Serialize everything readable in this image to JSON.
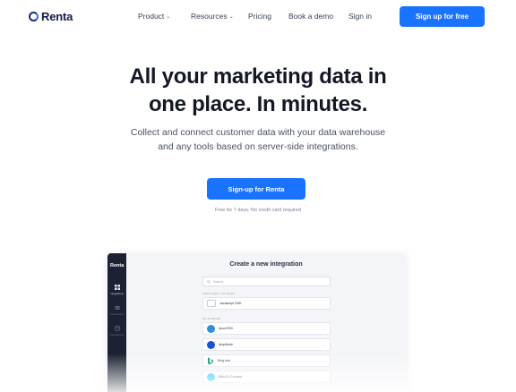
{
  "brand": {
    "name": "Renta",
    "accent": "#1a73ff",
    "dark": "#16194a"
  },
  "nav": {
    "links": [
      {
        "label": "Product",
        "has_caret": true
      },
      {
        "label": "Resources",
        "has_caret": true
      },
      {
        "label": "Pricing",
        "has_caret": false
      },
      {
        "label": "Book a demo",
        "has_caret": false
      },
      {
        "label": "Sign in",
        "has_caret": false
      }
    ],
    "caret_icon": "chevron-down-icon",
    "signup_label": "Sign up for free"
  },
  "hero": {
    "title_line1": "All your marketing data in",
    "title_line2": "one place. In minutes.",
    "subtitle_line1": "Collect and connect customer data with your data warehouse",
    "subtitle_line2": "and any tools based on server-side integrations.",
    "cta_label": "Sign-up for Renta",
    "cta_note": "Free for 7 days. No credit card required"
  },
  "preview": {
    "brand": "Renta",
    "sidebar": [
      {
        "label": "Integrations",
        "icon": "grid-icon"
      },
      {
        "label": "Connections",
        "icon": "link-icon"
      },
      {
        "label": "Destinations",
        "icon": "database-icon"
      }
    ],
    "title": "Create a new integration",
    "search_placeholder": "Search",
    "section_first_party": "FIRST-PARTY SOURCES",
    "first_party": [
      {
        "label": "Javascript SDK",
        "icon": "sdk-icon"
      }
    ],
    "section_ads": "AD SOURCES",
    "ad_sources": [
      {
        "label": "AmoCRM",
        "icon": "amocrm-icon",
        "color": "#2f8fd8"
      },
      {
        "label": "Amplitude",
        "icon": "amplitude-icon",
        "color": "#1f4fd1"
      },
      {
        "label": "Bing Ads",
        "icon": "bing-icon",
        "color": "#0a8a7a"
      },
      {
        "label": "Bitrix24 Connect",
        "icon": "bitrix-icon",
        "color": "#2fc7f7"
      }
    ]
  }
}
